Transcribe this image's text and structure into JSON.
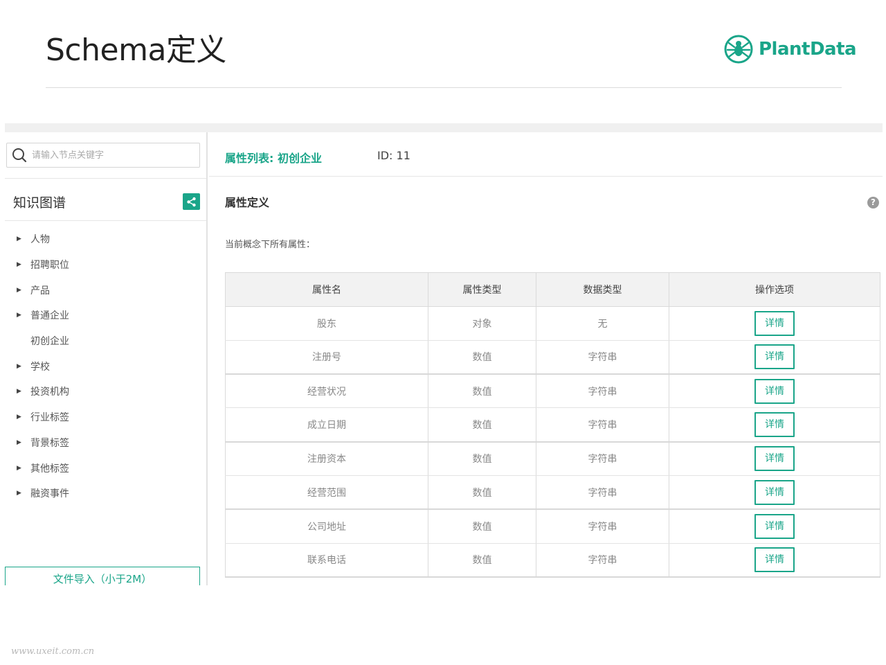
{
  "slide": {
    "title": "Schema定义",
    "brand": "PlantData",
    "watermark": "www.uxeit.com.cn"
  },
  "colors": {
    "accent": "#1aa589",
    "header_bg": "#f2f2f2",
    "border": "#dadada"
  },
  "sidebar": {
    "search_placeholder": "请输入节点关键字",
    "kg_title": "知识图谱",
    "kg_button_icon": "share-graph-icon",
    "items": [
      {
        "label": "人物",
        "expandable": true
      },
      {
        "label": "招聘职位",
        "expandable": true
      },
      {
        "label": "产品",
        "expandable": true
      },
      {
        "label": "普通企业",
        "expandable": true
      },
      {
        "label": "初创企业",
        "expandable": false
      },
      {
        "label": "学校",
        "expandable": true
      },
      {
        "label": "投资机构",
        "expandable": true
      },
      {
        "label": "行业标签",
        "expandable": true
      },
      {
        "label": "背景标签",
        "expandable": true
      },
      {
        "label": "其他标签",
        "expandable": true
      },
      {
        "label": "融资事件",
        "expandable": true
      }
    ],
    "import_label": "文件导入（小于2M）"
  },
  "main": {
    "title": "属性列表: 初创企业",
    "id_label": "ID: 11",
    "section_title": "属性定义",
    "help_icon": "question-circle-icon",
    "description": "当前概念下所有属性：",
    "table": {
      "headers": [
        "属性名",
        "属性类型",
        "数据类型",
        "操作选项"
      ],
      "rows": [
        [
          "股东",
          "对象",
          "无",
          "详情"
        ],
        [
          "注册号",
          "数值",
          "字符串",
          "详情"
        ],
        [
          "经营状况",
          "数值",
          "字符串",
          "详情"
        ],
        [
          "成立日期",
          "数值",
          "字符串",
          "详情"
        ],
        [
          "注册资本",
          "数值",
          "字符串",
          "详情"
        ],
        [
          "经营范围",
          "数值",
          "字符串",
          "详情"
        ],
        [
          "公司地址",
          "数值",
          "字符串",
          "详情"
        ],
        [
          "联系电话",
          "数值",
          "字符串",
          "详情"
        ]
      ]
    }
  }
}
